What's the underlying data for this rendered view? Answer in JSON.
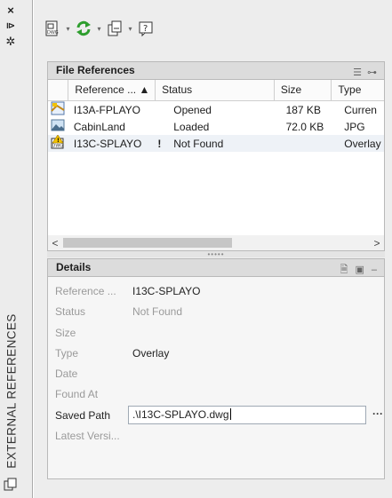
{
  "palette": {
    "vertical_title": "EXTERNAL REFERENCES",
    "close_glyph": "×",
    "autohide_glyph": "⧐",
    "properties_glyph": "✲"
  },
  "toolbar": {
    "attach_icon": "attach-dwg-icon",
    "refresh_icon": "refresh-icon",
    "change_path_icon": "change-path-icon",
    "help_icon": "help-icon",
    "dropdown_glyph": "▾"
  },
  "file_references": {
    "title": "File References",
    "columns": [
      {
        "label": "Reference ... ▲"
      },
      {
        "label": "Status"
      },
      {
        "label": "Size"
      },
      {
        "label": "Type"
      }
    ],
    "rows": [
      {
        "name": "I13A-FPLAYO",
        "flag": "",
        "status": "Opened",
        "size": "187 KB",
        "type": "Curren",
        "icon": "drawing-icon"
      },
      {
        "name": "CabinLand",
        "flag": "",
        "status": "Loaded",
        "size": "72.0 KB",
        "type": "JPG",
        "icon": "image-icon"
      },
      {
        "name": "I13C-SPLAYO",
        "flag": "!",
        "status": "Not Found",
        "size": "",
        "type": "Overlay",
        "icon": "dwg-warning-icon"
      }
    ],
    "scroll_left": "<",
    "scroll_right": ">",
    "splitter_grip": "•••••"
  },
  "details": {
    "title": "Details",
    "close_glyph": "–",
    "fields": [
      {
        "label": "Reference ...",
        "value": "I13C-SPLAYO",
        "dim": false
      },
      {
        "label": "Status",
        "value": "Not Found",
        "dim": true
      },
      {
        "label": "Size",
        "value": "",
        "dim": true
      },
      {
        "label": "Type",
        "value": "Overlay",
        "dim": false
      },
      {
        "label": "Date",
        "value": "",
        "dim": true
      },
      {
        "label": "Found At",
        "value": "",
        "dim": true
      }
    ],
    "saved_path": {
      "label": "Saved Path",
      "value": ".\\I13C-SPLAYO.dwg",
      "browse": "···"
    },
    "latest_version": {
      "label": "Latest Versi...",
      "value": ""
    }
  },
  "colors": {
    "accent_green": "#2e9e2e",
    "warning_yellow": "#f2c200",
    "selection": "#eef2f7"
  }
}
